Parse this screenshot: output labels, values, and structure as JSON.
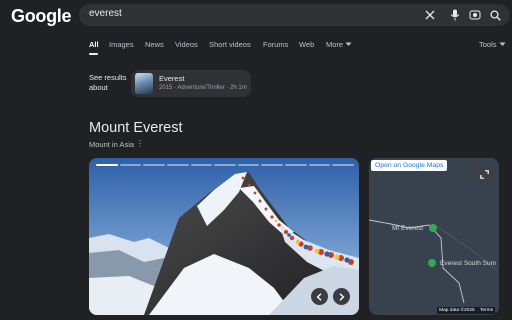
{
  "logo": "Google",
  "search": {
    "query": "everest"
  },
  "tabs": [
    "All",
    "Images",
    "News",
    "Videos",
    "Short videos",
    "Forums",
    "Web",
    "More"
  ],
  "tools_label": "Tools",
  "see_results": {
    "label": "See results about",
    "title": "Everest",
    "subtitle": "2015 · Adventure/Thriller · 2h 1m"
  },
  "knowledge_panel": {
    "title": "Mount Everest",
    "subtitle": "Mount in Asia"
  },
  "gallery": {
    "slide_count": 11,
    "current_slide": 1
  },
  "map": {
    "open_link": "Open on Google Maps",
    "places": [
      "Mt Everest",
      "Everest South Sum"
    ],
    "attribution": "Map data ©2025",
    "terms": "Terms"
  },
  "colors": {
    "background": "#202124",
    "link": "#1a73e8",
    "pin": "#34a853"
  }
}
